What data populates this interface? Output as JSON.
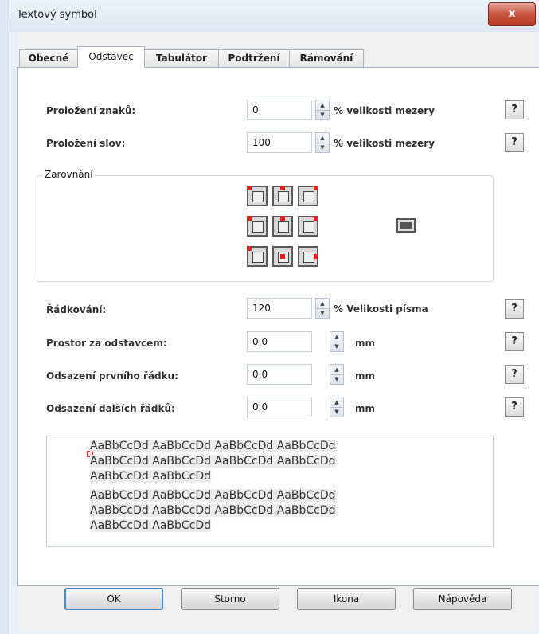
{
  "window": {
    "title": "Textový symbol",
    "close_label": "x"
  },
  "tabs": [
    "Obecné",
    "Odstavec",
    "Tabulátor",
    "Podtržení",
    "Rámování"
  ],
  "active_tab": "Odstavec",
  "spacing": {
    "char_label": "Proložení znaků:",
    "char_value": "0",
    "char_unit": "% velikosti mezery",
    "word_label": "Proložení slov:",
    "word_value": "100",
    "word_unit": "% velikosti mezery"
  },
  "alignment": {
    "group_label": "Zarovnání",
    "buttons": [
      "top-left",
      "top-center",
      "top-right",
      "middle-left",
      "middle-center",
      "middle-right",
      "bottom-left",
      "bottom-center",
      "bottom-right"
    ],
    "fill_button": "fill-frame"
  },
  "line": {
    "line_spacing_label": "Řádkování:",
    "line_spacing_value": "120",
    "line_spacing_unit": "% Velikosti písma",
    "space_after_label": "Prostor za odstavcem:",
    "space_after_value": "0,0",
    "space_after_unit": "mm",
    "first_indent_label": "Odsazení prvního řádku:",
    "first_indent_value": "0,0",
    "first_indent_unit": "mm",
    "other_indent_label": "Odsazení dalších řádků:",
    "other_indent_value": "0,0",
    "other_indent_unit": "mm"
  },
  "help_label": "?",
  "preview": {
    "lines": [
      "AaBbCcDd AaBbCcDd AaBbCcDd AaBbCcDd",
      "AaBbCcDd AaBbCcDd AaBbCcDd AaBbCcDd",
      "AaBbCcDd AaBbCcDd",
      "AaBbCcDd AaBbCcDd AaBbCcDd AaBbCcDd",
      "AaBbCcDd AaBbCcDd AaBbCcDd AaBbCcDd",
      "AaBbCcDd AaBbCcDd"
    ]
  },
  "buttons": {
    "ok": "OK",
    "cancel": "Storno",
    "icon": "Ikona",
    "help": "Nápověda"
  },
  "colors": {
    "default_button_border": "#3b8ddd",
    "close_button": "#c7553f",
    "anchor_marker": "#dd2222"
  }
}
